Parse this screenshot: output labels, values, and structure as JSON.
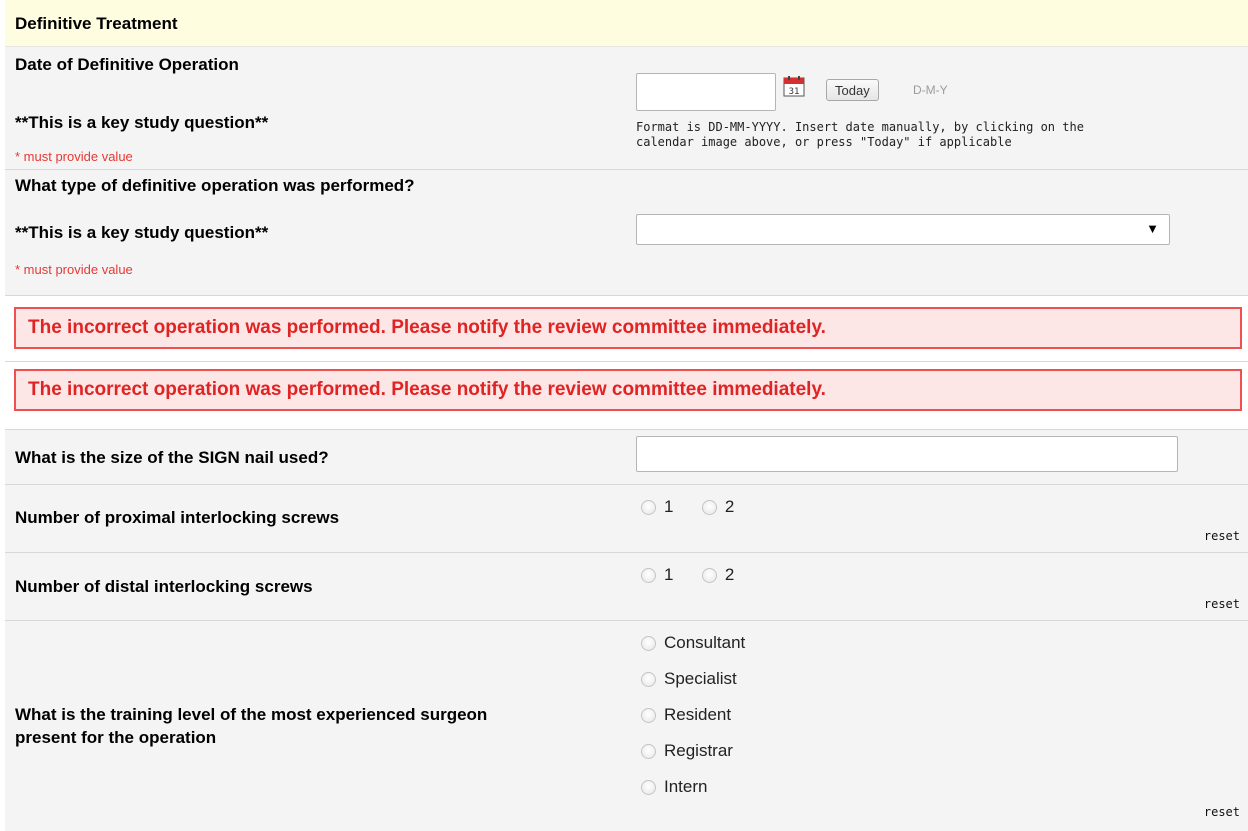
{
  "section": {
    "title": "Definitive Treatment"
  },
  "date_question": {
    "label": "Date of Definitive Operation",
    "key_note": "**This is a key study question**",
    "required": "* must provide value",
    "input_value": "",
    "today_label": "Today",
    "format_hint": "D-M-Y",
    "help_line1": "Format is DD-MM-YYYY. Insert date manually, by clicking on the",
    "help_line2": "calendar image above, or press \"Today\" if applicable",
    "calendar_icon": "calendar-icon"
  },
  "operation_type": {
    "label": "What type of definitive operation was performed?",
    "key_note": "**This is a key study question**",
    "required": "* must provide value",
    "selected": "",
    "dropdown_icon": "▼"
  },
  "alerts": [
    "The incorrect operation was performed. Please notify the review committee immediately.",
    "The incorrect operation was performed. Please notify the review committee immediately."
  ],
  "nail_size": {
    "label": "What is the size of the SIGN nail used?",
    "value": ""
  },
  "proximal_screws": {
    "label": "Number of proximal interlocking screws",
    "options": [
      "1",
      "2"
    ],
    "reset": "reset"
  },
  "distal_screws": {
    "label": "Number of distal interlocking screws",
    "options": [
      "1",
      "2"
    ],
    "reset": "reset"
  },
  "training_level": {
    "label_line1": "What is the training level of the most experienced surgeon",
    "label_line2": "present for the operation",
    "options": [
      "Consultant",
      "Specialist",
      "Resident",
      "Registrar",
      "Intern"
    ],
    "reset": "reset"
  },
  "colors": {
    "header_bg": "#fffde0",
    "row_bg": "#f4f4f4",
    "alert_border": "#ef4f4f",
    "alert_text": "#e02323",
    "required_text": "#e53935"
  }
}
